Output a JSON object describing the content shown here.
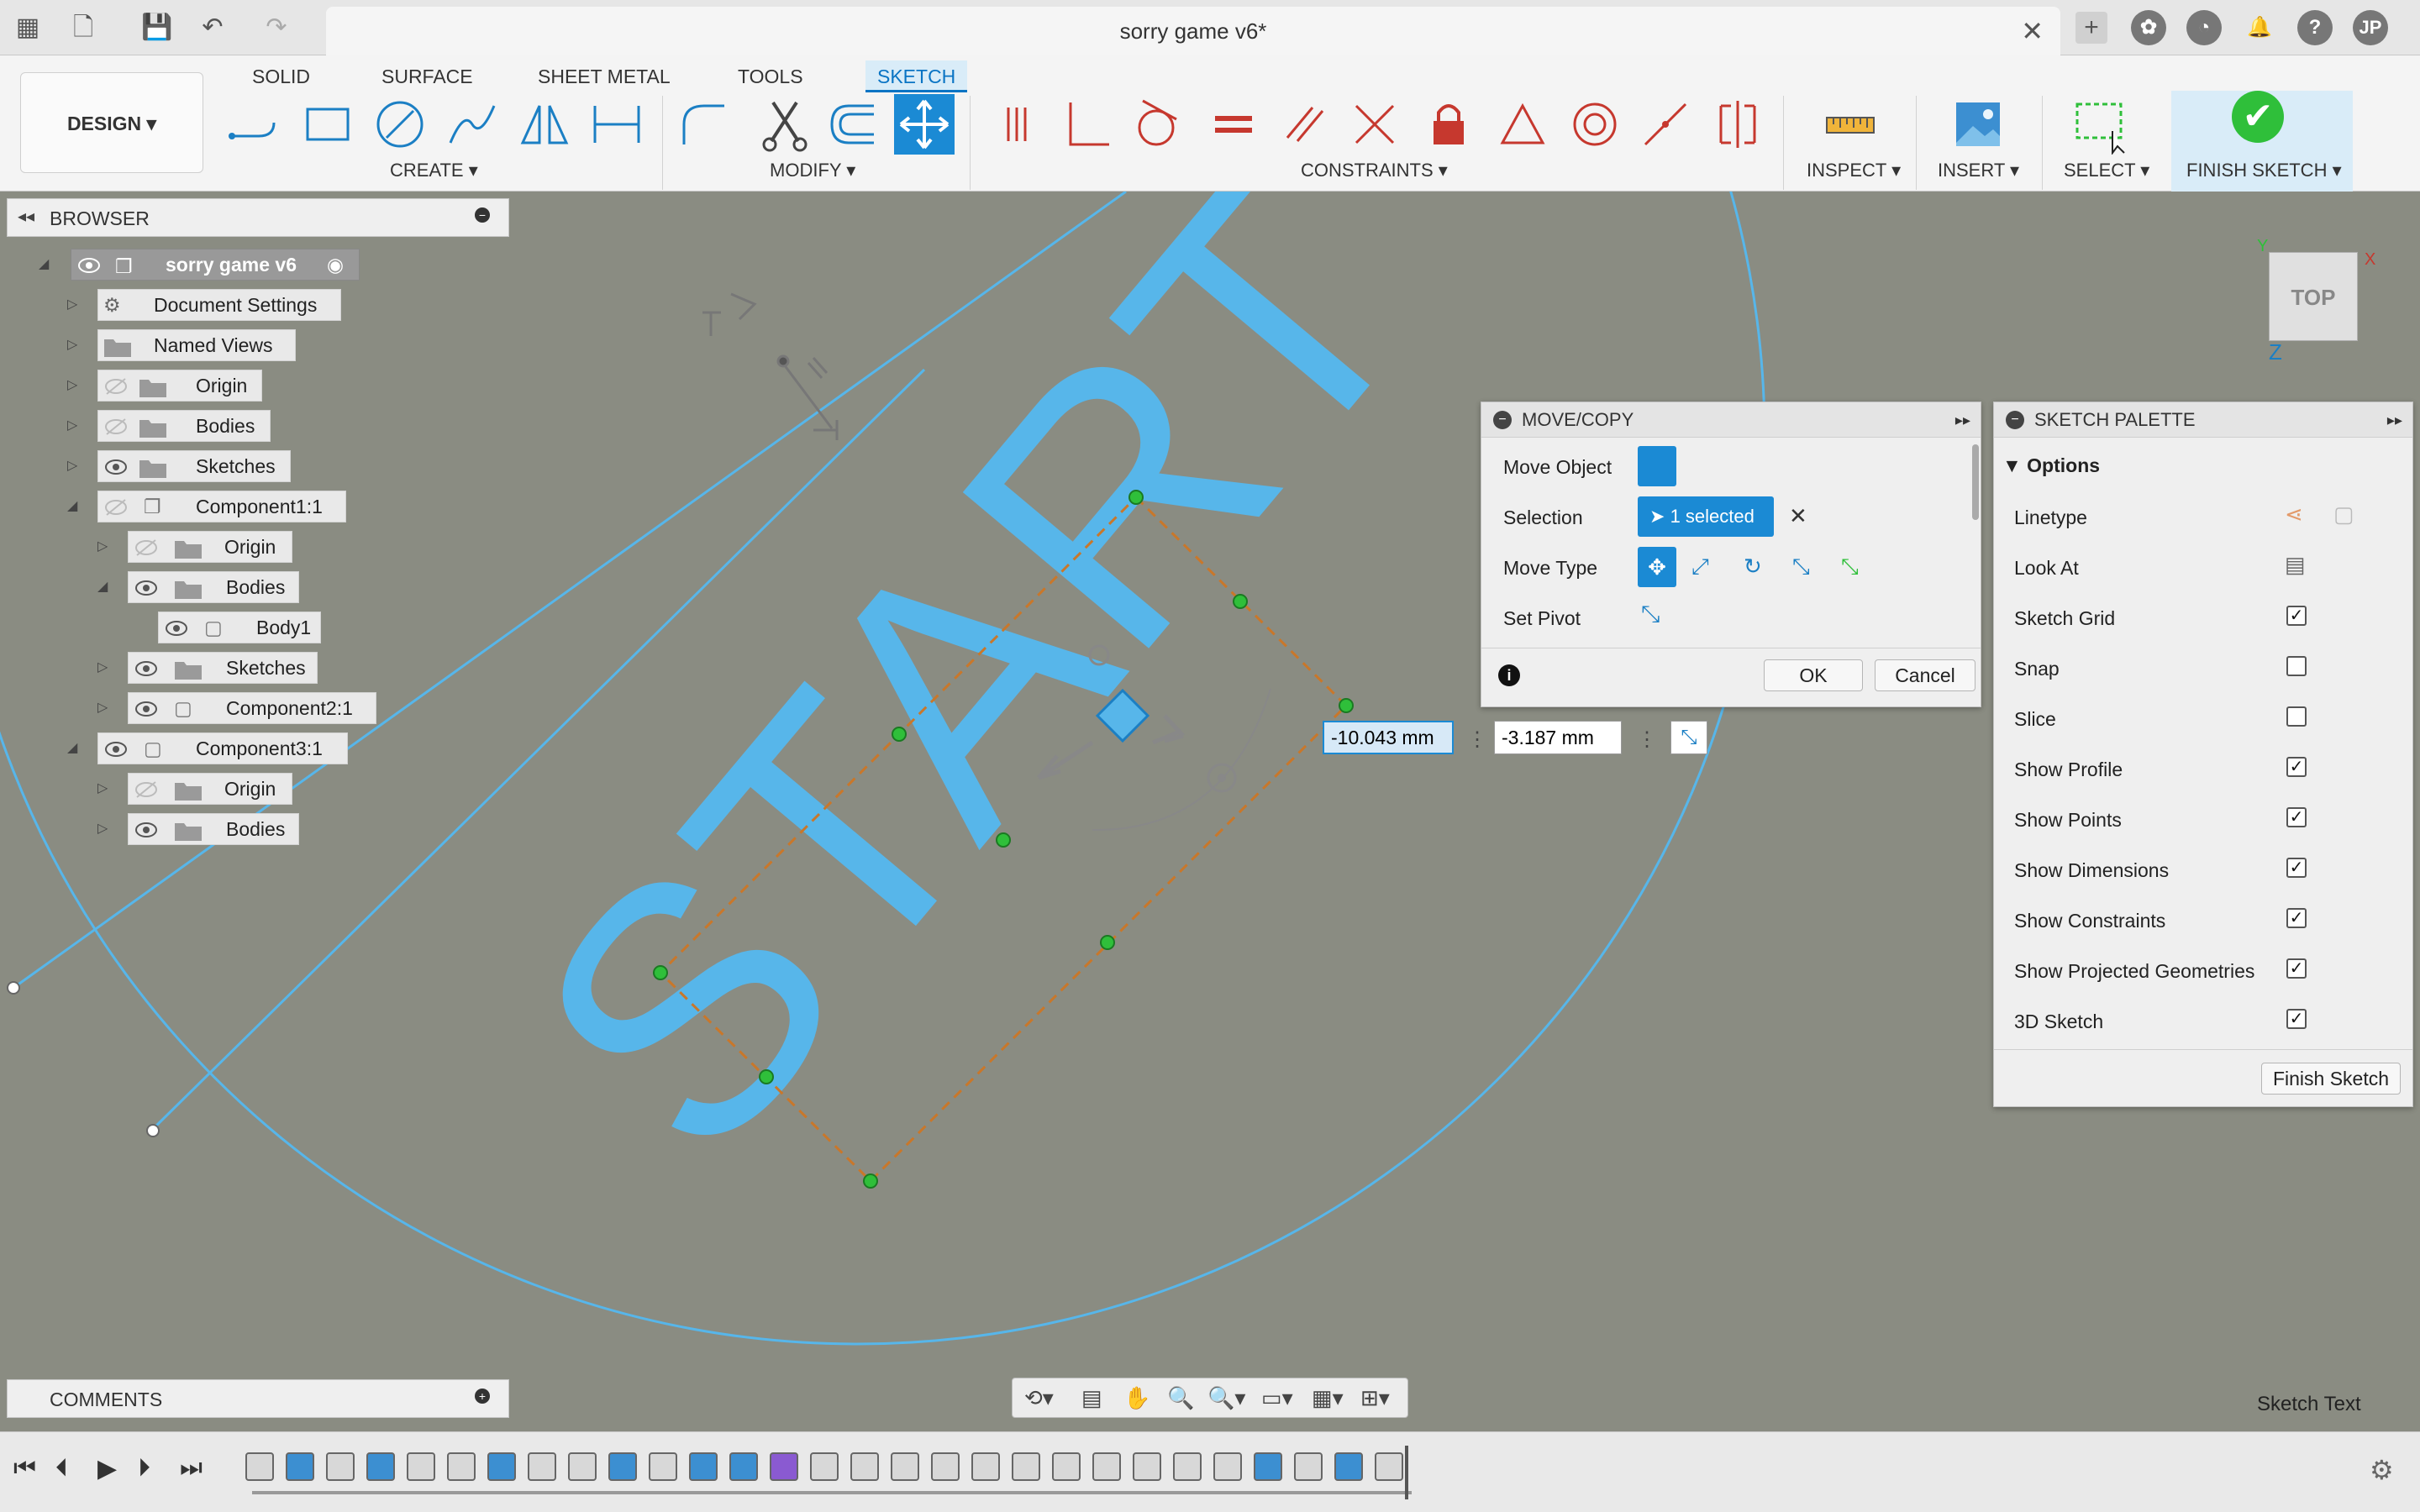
{
  "window": {
    "title": "sorry game v6*",
    "user_initials": "JP"
  },
  "workspace": {
    "label": "DESIGN"
  },
  "tabs": [
    "SOLID",
    "SURFACE",
    "SHEET METAL",
    "TOOLS",
    "SKETCH"
  ],
  "active_tab": "SKETCH",
  "toolbar_groups": {
    "create": "CREATE",
    "modify": "MODIFY",
    "constraints": "CONSTRAINTS",
    "inspect": "INSPECT",
    "insert": "INSERT",
    "select": "SELECT",
    "finish_sketch": "FINISH SKETCH"
  },
  "browser": {
    "title": "BROWSER",
    "items": [
      {
        "label": "sorry game v6",
        "depth": 0,
        "expanded": true
      },
      {
        "label": "Document Settings",
        "depth": 1
      },
      {
        "label": "Named Views",
        "depth": 1
      },
      {
        "label": "Origin",
        "depth": 1
      },
      {
        "label": "Bodies",
        "depth": 1
      },
      {
        "label": "Sketches",
        "depth": 1
      },
      {
        "label": "Component1:1",
        "depth": 1,
        "expanded": true
      },
      {
        "label": "Origin",
        "depth": 2
      },
      {
        "label": "Bodies",
        "depth": 2,
        "expanded": true
      },
      {
        "label": "Body1",
        "depth": 3
      },
      {
        "label": "Sketches",
        "depth": 2
      },
      {
        "label": "Component2:1",
        "depth": 2
      },
      {
        "label": "Component3:1",
        "depth": 1,
        "expanded": true
      },
      {
        "label": "Origin",
        "depth": 2
      },
      {
        "label": "Bodies",
        "depth": 2
      }
    ]
  },
  "comments": {
    "title": "COMMENTS"
  },
  "move_copy": {
    "title": "MOVE/COPY",
    "move_object_label": "Move Object",
    "selection_label": "Selection",
    "selection_value": "1 selected",
    "move_type_label": "Move Type",
    "set_pivot_label": "Set Pivot",
    "ok": "OK",
    "cancel": "Cancel"
  },
  "dimension_inputs": {
    "x": "-10.043 mm",
    "y": "-3.187 mm"
  },
  "sketch_palette": {
    "title": "SKETCH PALETTE",
    "section": "Options",
    "rows": [
      {
        "label": "Linetype",
        "type": "icons"
      },
      {
        "label": "Look At",
        "type": "icon"
      },
      {
        "label": "Sketch Grid",
        "checked": true
      },
      {
        "label": "Snap",
        "checked": false
      },
      {
        "label": "Slice",
        "checked": false
      },
      {
        "label": "Show Profile",
        "checked": true
      },
      {
        "label": "Show Points",
        "checked": true
      },
      {
        "label": "Show Dimensions",
        "checked": true
      },
      {
        "label": "Show Constraints",
        "checked": true
      },
      {
        "label": "Show Projected Geometries",
        "checked": true
      },
      {
        "label": "3D Sketch",
        "checked": true
      }
    ],
    "finish_button": "Finish Sketch"
  },
  "viewcube": {
    "face": "TOP",
    "axis_z": "Z",
    "axis_x": "X",
    "axis_y": "Y"
  },
  "canvas": {
    "sketch_text": "START",
    "status_text": "Sketch Text"
  },
  "colors": {
    "accent": "#0a74c4",
    "sketch": "#57b6ea",
    "green_check": "#2fbf3a",
    "background": "#8a8c82",
    "constraint_red": "#c6382e"
  }
}
